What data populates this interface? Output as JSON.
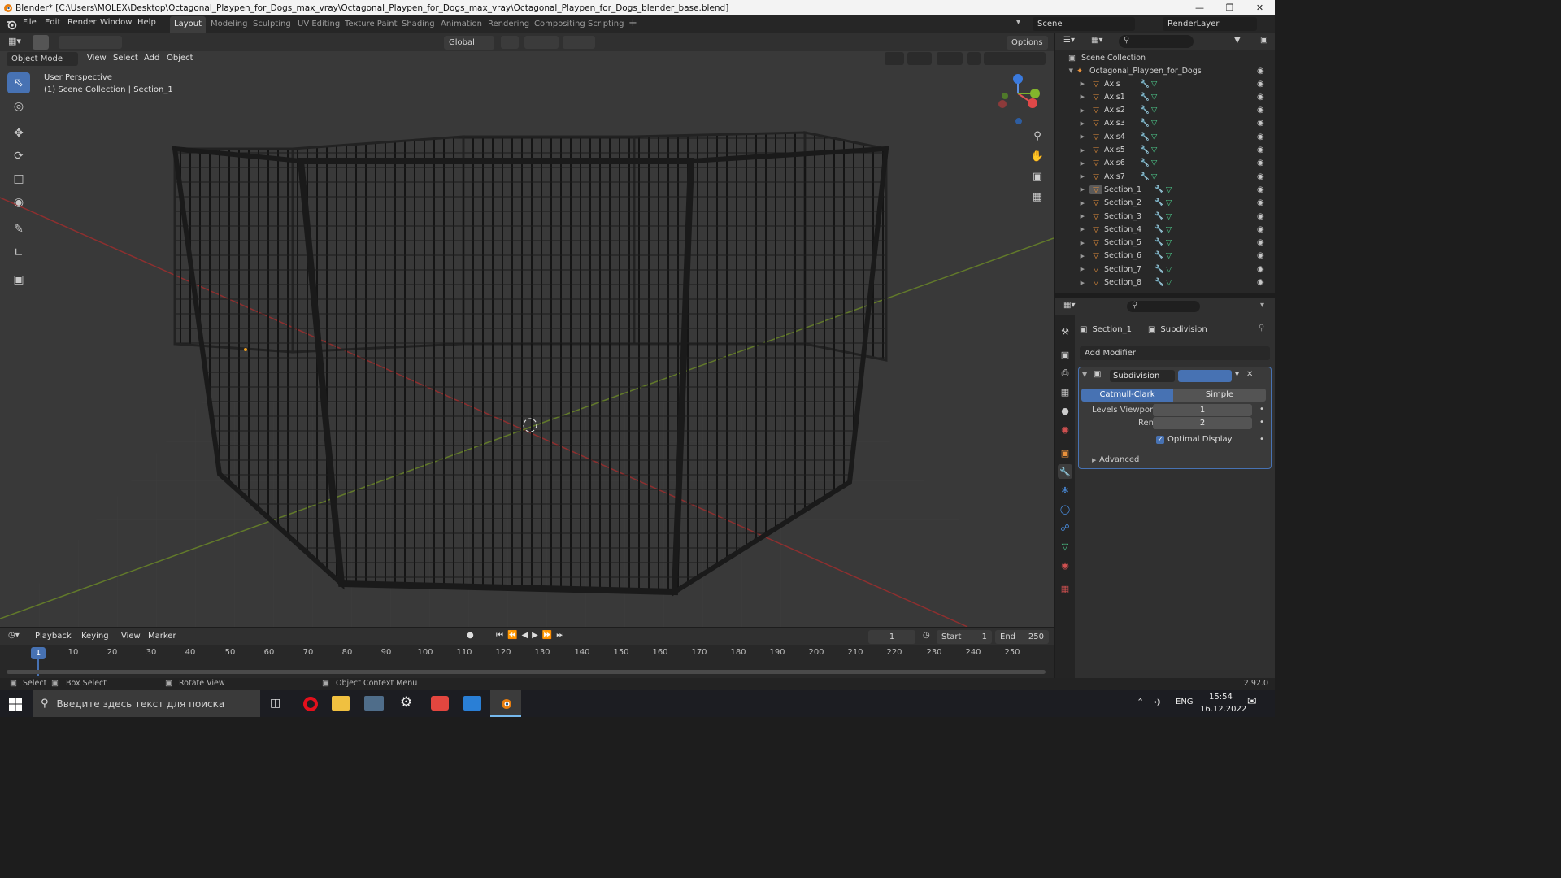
{
  "window": {
    "title": "Blender* [C:\\Users\\MOLEX\\Desktop\\Octagonal_Playpen_for_Dogs_max_vray\\Octagonal_Playpen_for_Dogs_max_vray\\Octagonal_Playpen_for_Dogs_blender_base.blend]"
  },
  "menu": {
    "file": "File",
    "edit": "Edit",
    "render": "Render",
    "window": "Window",
    "help": "Help"
  },
  "workspaces": [
    "Layout",
    "Modeling",
    "Sculpting",
    "UV Editing",
    "Texture Paint",
    "Shading",
    "Animation",
    "Rendering",
    "Compositing",
    "Scripting"
  ],
  "workspace_add": "+",
  "scene": {
    "name": "Scene",
    "layer": "RenderLayer"
  },
  "viewport_header": {
    "orientation": "Global",
    "options": "Options",
    "mode": "Object Mode",
    "view": "View",
    "select": "Select",
    "add": "Add",
    "object": "Object"
  },
  "viewport": {
    "perspective": "User Perspective",
    "collection_info": "(1) Scene Collection | Section_1"
  },
  "outliner": {
    "root": "Scene Collection",
    "collection": "Octagonal_Playpen_for_Dogs",
    "items": [
      "Axis",
      "Axis1",
      "Axis2",
      "Axis3",
      "Axis4",
      "Axis5",
      "Axis6",
      "Axis7",
      "Section_1",
      "Section_2",
      "Section_3",
      "Section_4",
      "Section_5",
      "Section_6",
      "Section_7",
      "Section_8"
    ]
  },
  "properties": {
    "object_name": "Section_1",
    "modifier_breadcrumb": "Subdivision",
    "add_modifier": "Add Modifier",
    "modifier_name": "Subdivision",
    "algo_catmull": "Catmull-Clark",
    "algo_simple": "Simple",
    "levels_viewport_label": "Levels Viewport",
    "levels_viewport_value": "1",
    "render_label": "Render",
    "render_value": "2",
    "optimal_display": "Optimal Display",
    "advanced": "Advanced"
  },
  "timeline": {
    "playback": "Playback",
    "keying": "Keying",
    "view": "View",
    "marker": "Marker",
    "current_frame": "1",
    "start_label": "Start",
    "start_value": "1",
    "end_label": "End",
    "end_value": "250",
    "ticks": [
      "10",
      "20",
      "30",
      "40",
      "50",
      "60",
      "70",
      "80",
      "90",
      "100",
      "110",
      "120",
      "130",
      "140",
      "150",
      "160",
      "170",
      "180",
      "190",
      "200",
      "210",
      "220",
      "230",
      "240",
      "250"
    ],
    "current_marker": "1"
  },
  "status": {
    "select": "Select",
    "box_select": "Box Select",
    "rotate_view": "Rotate View",
    "context_menu": "Object Context Menu",
    "version": "2.92.0"
  },
  "taskbar": {
    "search_placeholder": "Введите здесь текст для поиска",
    "lang": "ENG",
    "time": "15:54",
    "date": "16.12.2022"
  },
  "colors": {
    "accent": "#4772b3",
    "object_orange": "#e9913b",
    "mesh_green": "#4cc88a",
    "axis_red": "#b23c3c",
    "axis_green": "#6d8a2c"
  }
}
